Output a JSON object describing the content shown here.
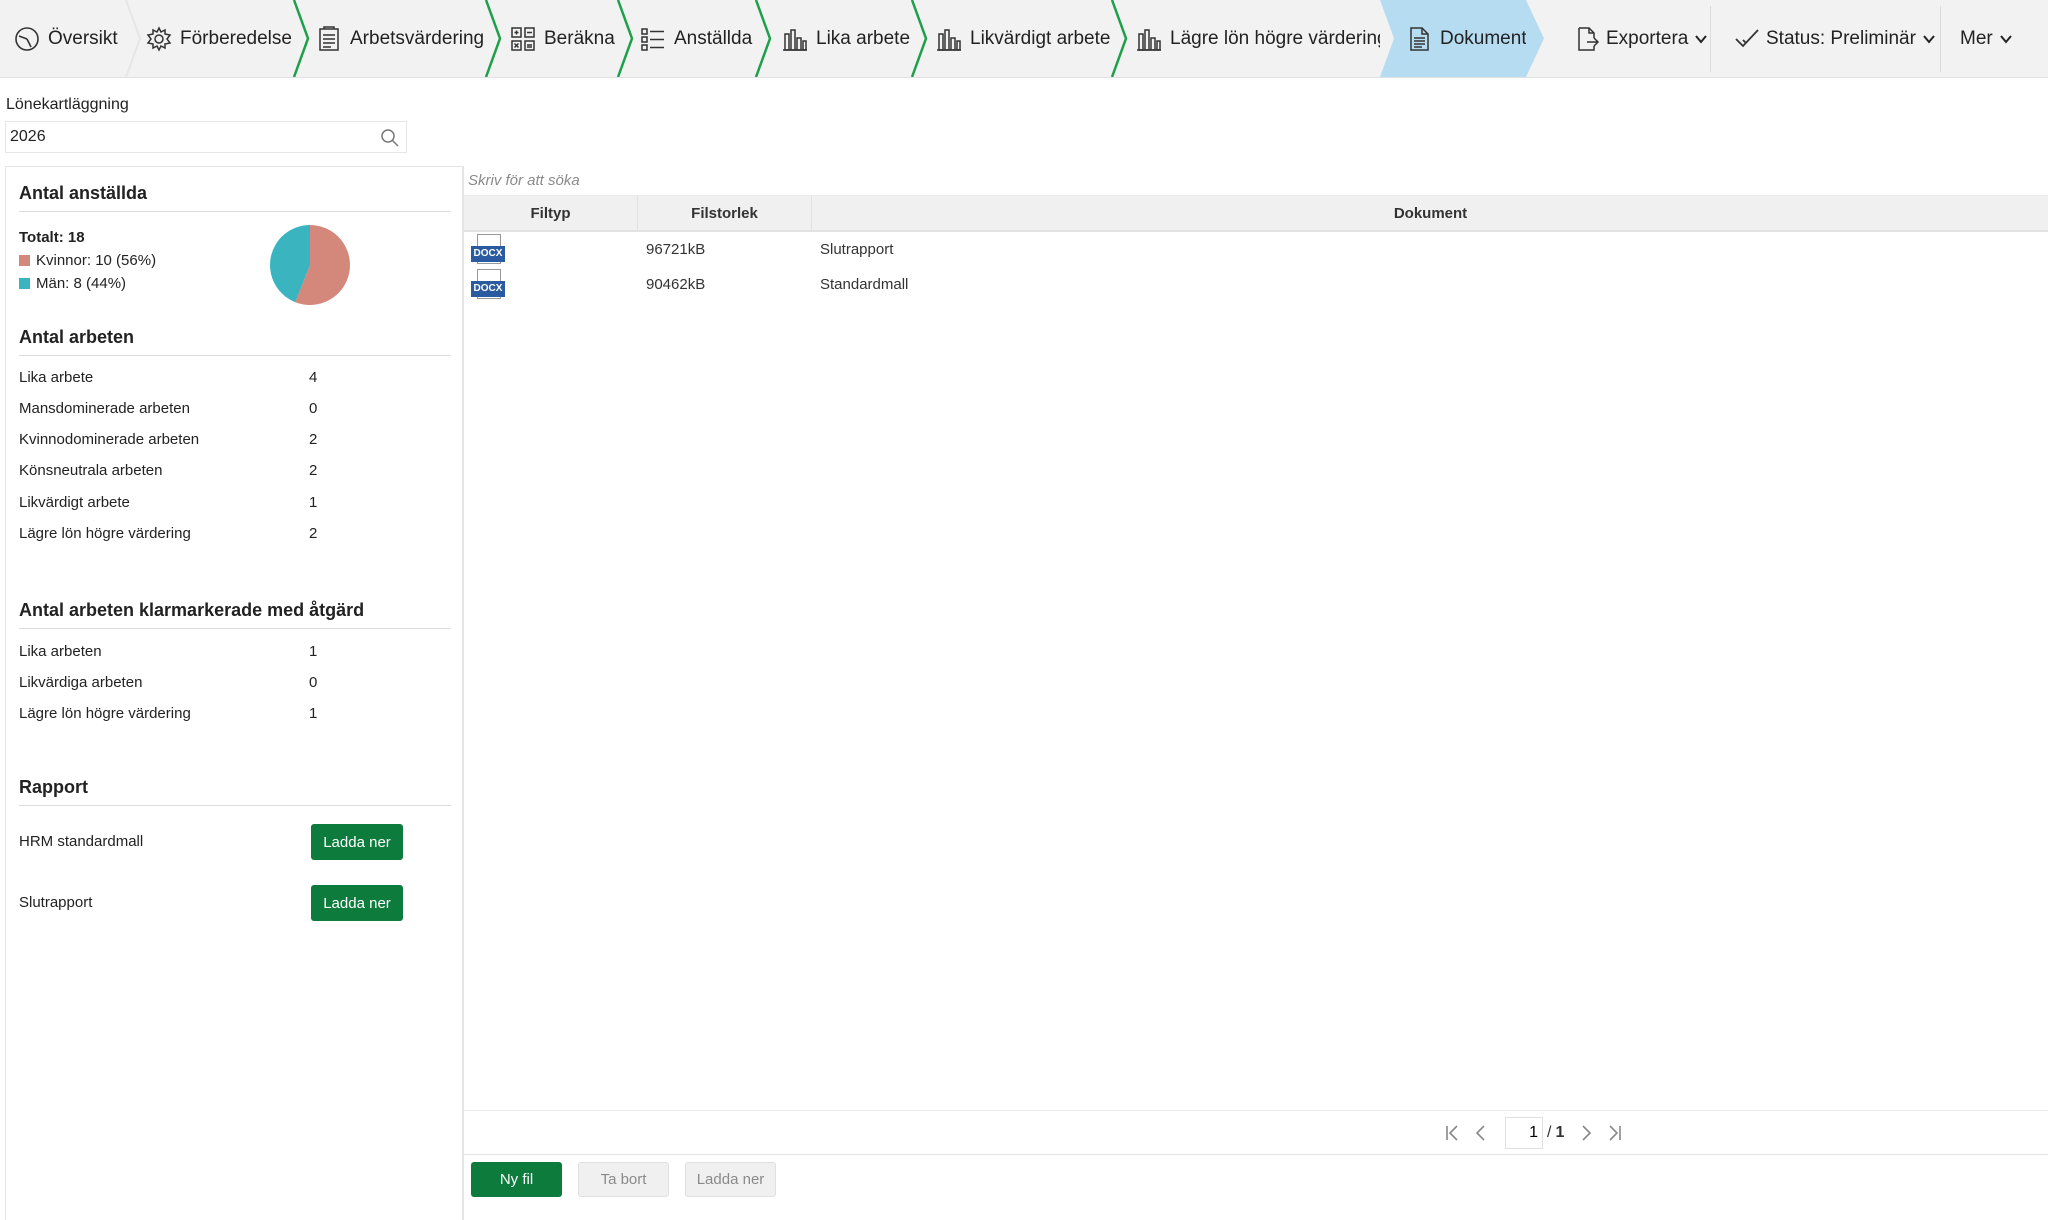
{
  "nav": {
    "steps": [
      {
        "label": "Översikt",
        "icon": "gauge-icon"
      },
      {
        "label": "Förberedelse",
        "icon": "gear-icon"
      },
      {
        "label": "Arbetsvärdering",
        "icon": "checklist-icon"
      },
      {
        "label": "Beräkna",
        "icon": "calculator-icon"
      },
      {
        "label": "Anställda",
        "icon": "list-icon"
      },
      {
        "label": "Lika arbete",
        "icon": "bar-chart-icon"
      },
      {
        "label": "Likvärdigt arbete",
        "icon": "bar-chart-icon"
      },
      {
        "label": "Lägre lön högre värdering",
        "icon": "bar-chart-icon"
      },
      {
        "label": "Dokument",
        "icon": "document-icon"
      }
    ],
    "active_step": "Dokument",
    "export_label": "Exportera",
    "status_label": "Status: Preliminär",
    "more_label": "Mer"
  },
  "filter": {
    "label": "Lönekartläggning",
    "value": "2026"
  },
  "employees": {
    "title": "Antal anställda",
    "total_label": "Totalt: 18",
    "women_label": "Kvinnor: 10 (56%)",
    "men_label": "Män: 8 (44%)",
    "women_color": "#d4877b",
    "men_color": "#3ab5c0",
    "women_fraction": 0.56,
    "men_fraction": 0.44
  },
  "jobs": {
    "title": "Antal arbeten",
    "rows": [
      {
        "label": "Lika arbete",
        "value": "4"
      },
      {
        "label": "Mansdominerade arbeten",
        "value": "0"
      },
      {
        "label": "Kvinnodominerade arbeten",
        "value": "2"
      },
      {
        "label": "Könsneutrala arbeten",
        "value": "2"
      },
      {
        "label": "Likvärdigt arbete",
        "value": "1"
      },
      {
        "label": "Lägre lön högre värdering",
        "value": "2"
      }
    ]
  },
  "marked": {
    "title": "Antal arbeten klarmarkerade med åtgärd",
    "rows": [
      {
        "label": "Lika arbeten",
        "value": "1"
      },
      {
        "label": "Likvärdiga arbeten",
        "value": "0"
      },
      {
        "label": "Lägre lön högre värdering",
        "value": "1"
      }
    ]
  },
  "report": {
    "title": "Rapport",
    "rows": [
      {
        "label": "HRM standardmall",
        "button": "Ladda ner"
      },
      {
        "label": "Slutrapport",
        "button": "Ladda ner"
      }
    ]
  },
  "documents": {
    "search_placeholder": "Skriv för att söka",
    "columns": [
      "Filtyp",
      "Filstorlek",
      "Dokument"
    ],
    "rows": [
      {
        "type": "DOCX",
        "size": "96721kB",
        "name": "Slutrapport"
      },
      {
        "type": "DOCX",
        "size": "90462kB",
        "name": "Standardmall"
      }
    ]
  },
  "pager": {
    "current": "1",
    "separator": "/",
    "total": "1"
  },
  "footer": {
    "new_file": "Ny fil",
    "delete": "Ta bort",
    "download": "Ladda ner"
  },
  "colors": {
    "accent_green": "#0c7b3c",
    "active_tab": "#b6dcf2",
    "step_arrow": "#1ea04b"
  }
}
